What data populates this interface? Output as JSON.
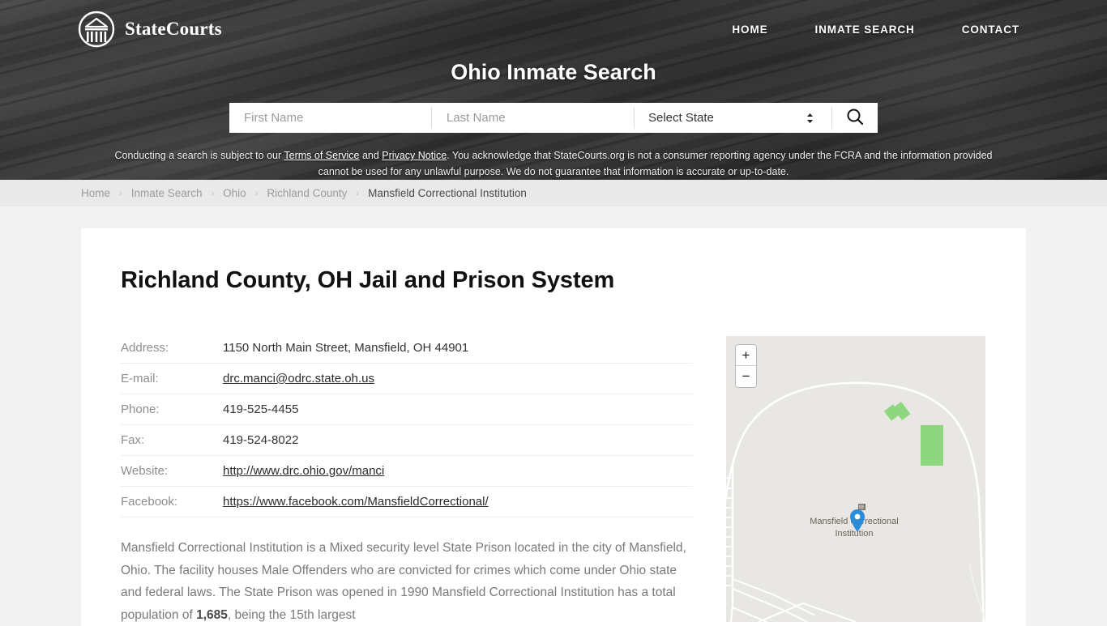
{
  "header": {
    "brand": "StateCourts",
    "logo_icon": "courthouse-circle-icon",
    "nav": [
      {
        "label": "HOME",
        "name": "home"
      },
      {
        "label": "INMATE SEARCH",
        "name": "inmate-search"
      },
      {
        "label": "CONTACT",
        "name": "contact"
      }
    ],
    "title": "Ohio Inmate Search",
    "search": {
      "first_name_placeholder": "First Name",
      "first_name_value": "",
      "last_name_placeholder": "Last Name",
      "last_name_value": "",
      "state_selected": "Select State",
      "search_icon": "magnifier-icon"
    },
    "disclaimer": {
      "part1": "Conducting a search is subject to our ",
      "link1": "Terms of Service",
      "part2": " and ",
      "link2": "Privacy Notice",
      "part3": ". You acknowledge that StateCourts.org is not a consumer reporting agency under the FCRA and the information provided cannot be used for any unlawful purpose. We do not guarantee that information is accurate or up-to-date."
    }
  },
  "breadcrumb": {
    "items": [
      {
        "label": "Home"
      },
      {
        "label": "Inmate Search"
      },
      {
        "label": "Ohio"
      },
      {
        "label": "Richland County"
      }
    ],
    "current": "Mansfield Correctional Institution",
    "separator": "›"
  },
  "main": {
    "title": "Richland County, OH Jail and Prison System",
    "facts": [
      {
        "label": "Address:",
        "value": "1150 North Main Street, Mansfield, OH 44901",
        "link": false
      },
      {
        "label": "E-mail:",
        "value": "drc.manci@odrc.state.oh.us",
        "link": true
      },
      {
        "label": "Phone:",
        "value": "419-525-4455",
        "link": false
      },
      {
        "label": "Fax:",
        "value": "419-524-8022",
        "link": false
      },
      {
        "label": "Website:",
        "value": "http://www.drc.ohio.gov/manci",
        "link": true
      },
      {
        "label": "Facebook:",
        "value": "https://www.facebook.com/MansfieldCorrectional/",
        "link": true
      }
    ],
    "description": {
      "text1": "Mansfield Correctional Institution is a Mixed security level State Prison located in the city of Mansfield, Ohio. The facility houses Male Offenders who are convicted for crimes which come under Ohio state and federal laws. The State Prison was opened in 1990 Mansfield Correctional Institution has a total population of ",
      "population": "1,685",
      "text2": ", being the 15th largest"
    }
  },
  "map": {
    "zoom_in_label": "+",
    "zoom_out_label": "−",
    "marker_label_line1": "Mansfield Correctional",
    "marker_label_line2": "Institution",
    "marker_icon": "map-pin-icon",
    "poi_icon": "building-icon",
    "colors": {
      "park_green": "#8ed77e",
      "marker_blue": "#2b8cd9",
      "land": "#e8e7e4"
    }
  }
}
